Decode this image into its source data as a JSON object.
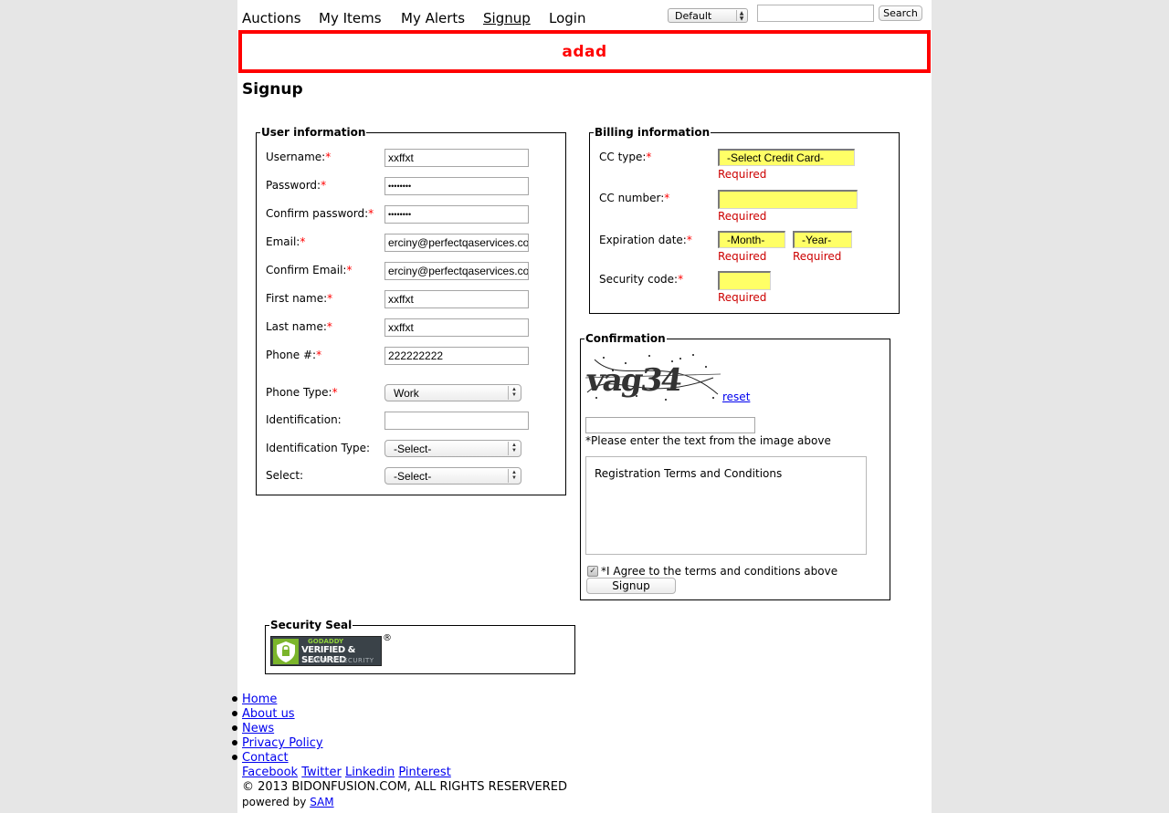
{
  "nav": {
    "items": [
      "Auctions",
      "My Items",
      "My Alerts",
      "Signup",
      "Login"
    ],
    "theme_selected": "Default",
    "search_value": "",
    "search_button": "Search"
  },
  "alert_message": "adad",
  "page_title": "Signup",
  "user_info": {
    "legend": "User information",
    "username_label": "Username:",
    "username_value": "xxffxt",
    "password_label": "Password:",
    "password_value": "••••••••",
    "confirm_password_label": "Confirm password:",
    "confirm_password_value": "••••••••",
    "email_label": "Email:",
    "email_value": "erciny@perfectqaservices.com",
    "confirm_email_label": "Confirm Email:",
    "confirm_email_value": "erciny@perfectqaservices.com",
    "first_name_label": "First name:",
    "first_name_value": "xxffxt",
    "last_name_label": "Last name:",
    "last_name_value": "xxffxt",
    "phone_label": "Phone #:",
    "phone_value": "222222222",
    "phone_type_label": "Phone Type:",
    "phone_type_value": "Work",
    "identification_label": "Identification:",
    "identification_value": "",
    "identification_type_label": "Identification Type:",
    "identification_type_value": "-Select-",
    "select_label": "Select:",
    "select_value": "-Select-",
    "required_mark": "*"
  },
  "billing": {
    "legend": "Billing information",
    "cc_type_label": "CC type:",
    "cc_type_value": "-Select Credit Card-",
    "cc_number_label": "CC number:",
    "cc_number_value": "",
    "expiration_label": "Expiration date:",
    "month_value": "-Month-",
    "year_value": "-Year-",
    "security_code_label": "Security code:",
    "security_code_value": "",
    "required_text": "Required"
  },
  "confirmation": {
    "legend": "Confirmation",
    "captcha_text": "vag34",
    "reset_link": "reset",
    "captcha_input_value": "",
    "captcha_hint": "*Please enter the text from the image above",
    "terms_text": "Registration Terms and Conditions",
    "agree_text": "*I Agree to the terms and conditions above",
    "agree_checked": true,
    "signup_button": "Signup"
  },
  "security_seal": {
    "legend": "Security Seal",
    "badge_line1": "GODADDY",
    "badge_line2": "VERIFIED & SECURED",
    "badge_line3": "VERIFY SECURITY",
    "registered_mark": "®"
  },
  "footer": {
    "links": [
      "Home",
      "About us",
      "News",
      "Privacy Policy",
      "Contact"
    ],
    "social": [
      "Facebook",
      "Twitter",
      "Linkedin",
      "Pinterest"
    ],
    "copyright": "© 2013 BIDONFUSION.COM, ALL RIGHTS RESERVERED",
    "powered_by": "powered by",
    "powered_link": "SAM"
  },
  "colors": {
    "alert": "#ff0000",
    "required_field_bg": "#ffff66",
    "link": "#0000ee",
    "required_text": "#cc0000"
  }
}
